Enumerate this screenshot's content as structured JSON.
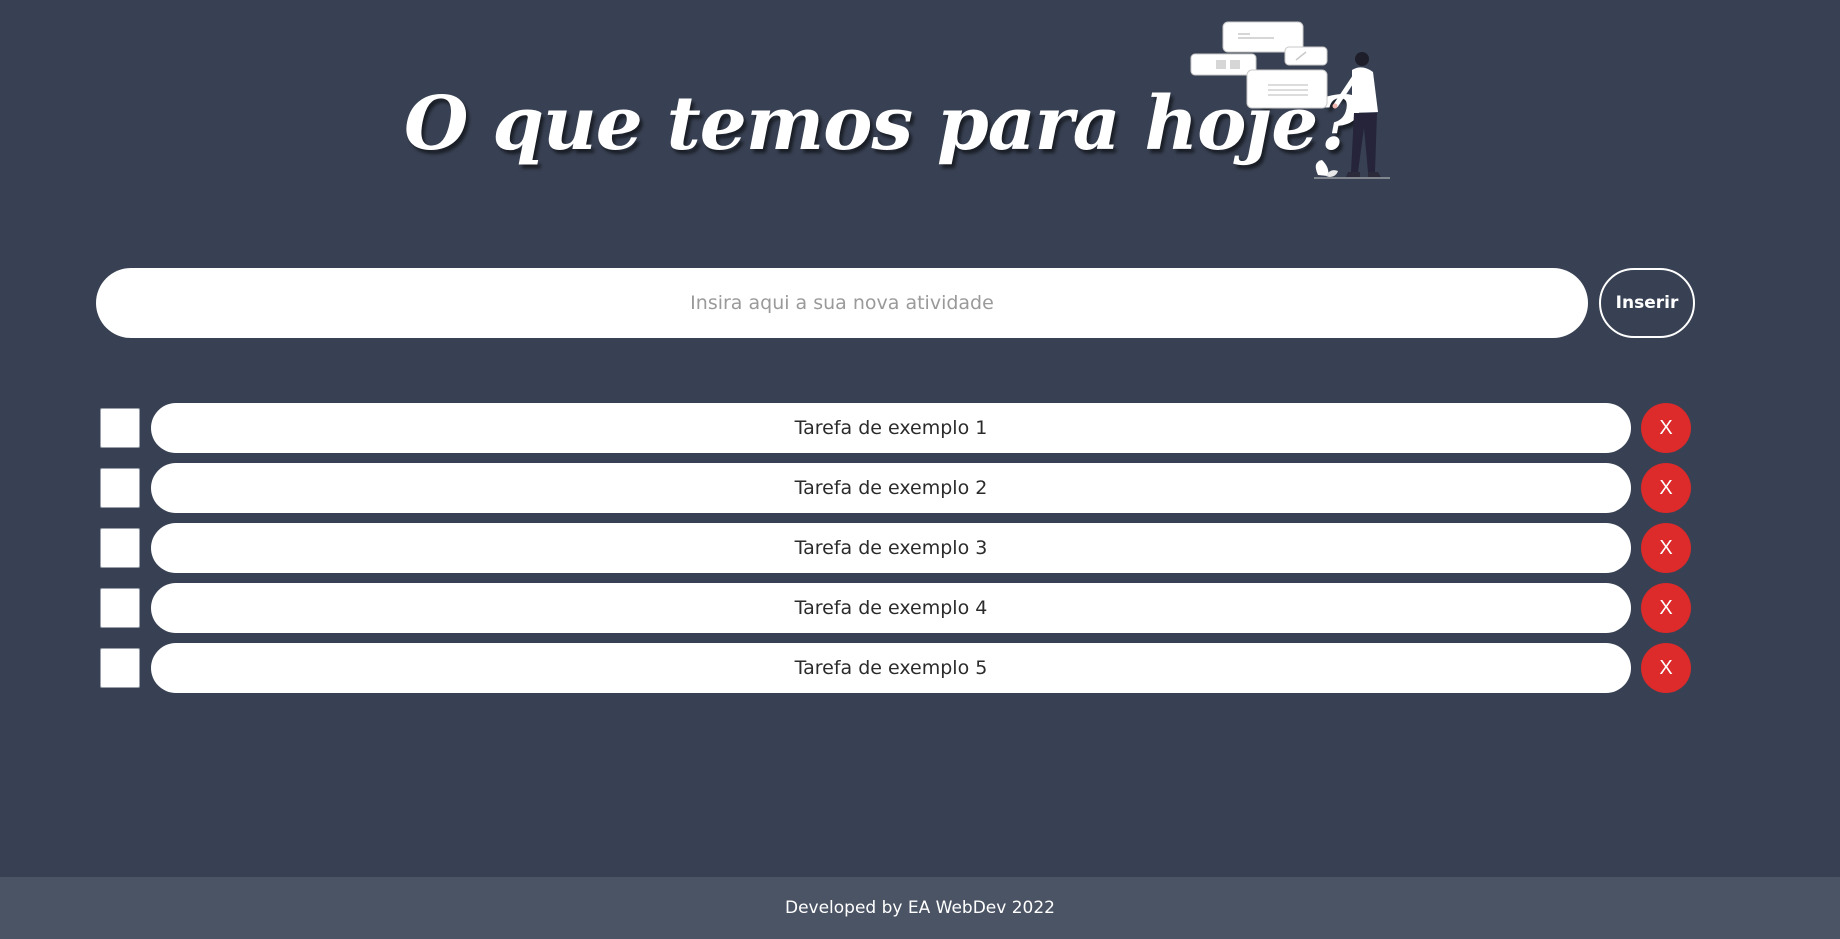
{
  "header": {
    "title": "O que temos para hoje?",
    "illustration_icon": "person-with-chat-cards-illustration"
  },
  "new_task": {
    "placeholder": "Insira aqui a sua nova atividade",
    "value": "",
    "insert_label": "Inserir"
  },
  "tasks": [
    {
      "label": "Tarefa de exemplo 1",
      "checked": false,
      "delete_label": "X"
    },
    {
      "label": "Tarefa de exemplo 2",
      "checked": false,
      "delete_label": "X"
    },
    {
      "label": "Tarefa de exemplo 3",
      "checked": false,
      "delete_label": "X"
    },
    {
      "label": "Tarefa de exemplo 4",
      "checked": false,
      "delete_label": "X"
    },
    {
      "label": "Tarefa de exemplo 5",
      "checked": false,
      "delete_label": "X"
    }
  ],
  "footer": {
    "text": "Developed by EA WebDev 2022"
  },
  "colors": {
    "background": "#384153",
    "footer_background": "#4b5465",
    "delete_button": "#dd2a2a",
    "pill": "#ffffff"
  }
}
